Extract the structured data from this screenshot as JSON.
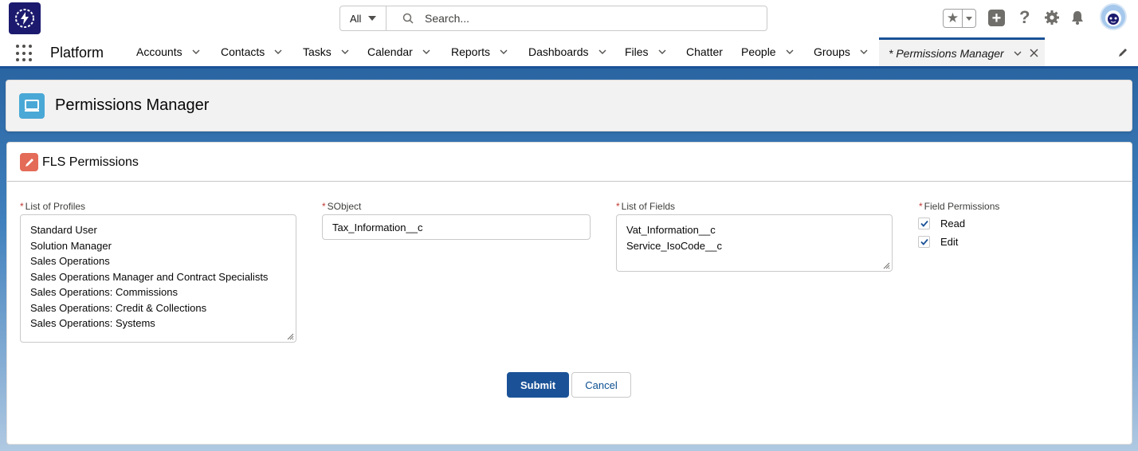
{
  "header": {
    "search_scope": "All",
    "search_placeholder": "Search..."
  },
  "nav": {
    "app_name": "Platform",
    "items": [
      {
        "label": "Accounts"
      },
      {
        "label": "Contacts"
      },
      {
        "label": "Tasks"
      },
      {
        "label": "Calendar"
      },
      {
        "label": "Reports"
      },
      {
        "label": "Dashboards"
      },
      {
        "label": "Files"
      },
      {
        "label": "Chatter"
      },
      {
        "label": "People"
      },
      {
        "label": "Groups"
      }
    ],
    "active_tab": "* Permissions Manager"
  },
  "page": {
    "title": "Permissions Manager"
  },
  "card": {
    "title": "FLS Permissions",
    "profiles": {
      "label": "List of Profiles",
      "required": "*",
      "values": [
        "Standard User",
        "Solution Manager",
        "Sales Operations",
        "Sales Operations Manager and Contract Specialists",
        "Sales Operations: Commissions",
        "Sales Operations: Credit & Collections",
        "Sales Operations: Systems"
      ]
    },
    "sobject": {
      "label": "SObject",
      "required": "*",
      "value": "Tax_Information__c"
    },
    "fields": {
      "label": "List of Fields",
      "required": "*",
      "values": [
        "Vat_Information__c",
        "Service_IsoCode__c"
      ]
    },
    "permissions": {
      "label": "Field Permissions",
      "required": "*",
      "options": [
        {
          "label": "Read",
          "checked": true
        },
        {
          "label": "Edit",
          "checked": true
        }
      ]
    },
    "submit_label": "Submit",
    "cancel_label": "Cancel"
  },
  "colors": {
    "brand": "#1b5297",
    "logo_bg": "#1b1a6e",
    "page_icon": "#4aa8d6",
    "card_icon": "#e36b58",
    "required": "#c23934"
  }
}
